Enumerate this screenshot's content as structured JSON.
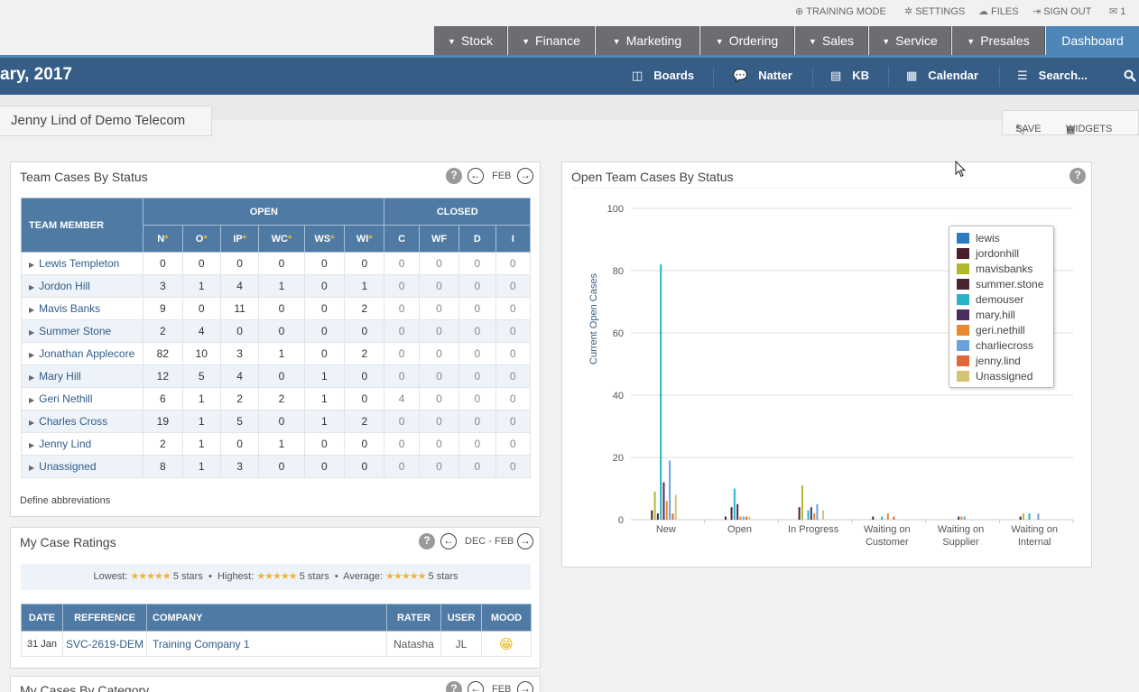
{
  "util": {
    "training": "TRAINING MODE",
    "settings": "SETTINGS",
    "files": "FILES",
    "signout": "SIGN OUT",
    "messages": "1"
  },
  "tabs": [
    "Stock",
    "Finance",
    "Marketing",
    "Ordering",
    "Sales",
    "Service",
    "Presales",
    "Dashboard"
  ],
  "nav": {
    "date_title": "ary, 2017",
    "boards": "Boards",
    "natter": "Natter",
    "kb": "KB",
    "calendar": "Calendar",
    "search": "Search..."
  },
  "context": {
    "user_tab": "Jenny Lind of Demo Telecom",
    "save": "SAVE",
    "widgets": "WIDGETS"
  },
  "team_cases": {
    "title": "Team Cases By Status",
    "period": "FEB",
    "header_member": "TEAM MEMBER",
    "header_open": "OPEN",
    "header_closed": "CLOSED",
    "open_cols": [
      "N",
      "O",
      "IP",
      "WC",
      "WS",
      "WI"
    ],
    "closed_cols": [
      "C",
      "WF",
      "D",
      "I"
    ],
    "rows": [
      {
        "name": "Lewis Templeton",
        "vals": [
          "0",
          "0",
          "0",
          "0",
          "0",
          "0",
          "0",
          "0",
          "0",
          "0"
        ]
      },
      {
        "name": "Jordon Hill",
        "vals": [
          "3",
          "1",
          "4",
          "1",
          "0",
          "1",
          "0",
          "0",
          "0",
          "0"
        ]
      },
      {
        "name": "Mavis Banks",
        "vals": [
          "9",
          "0",
          "11",
          "0",
          "0",
          "2",
          "0",
          "0",
          "0",
          "0"
        ]
      },
      {
        "name": "Summer Stone",
        "vals": [
          "2",
          "4",
          "0",
          "0",
          "0",
          "0",
          "0",
          "0",
          "0",
          "0"
        ]
      },
      {
        "name": "Jonathan Applecore",
        "vals": [
          "82",
          "10",
          "3",
          "1",
          "0",
          "2",
          "0",
          "0",
          "0",
          "0"
        ]
      },
      {
        "name": "Mary Hill",
        "vals": [
          "12",
          "5",
          "4",
          "0",
          "1",
          "0",
          "0",
          "0",
          "0",
          "0"
        ]
      },
      {
        "name": "Geri Nethill",
        "vals": [
          "6",
          "1",
          "2",
          "2",
          "1",
          "0",
          "4",
          "0",
          "0",
          "0"
        ]
      },
      {
        "name": "Charles Cross",
        "vals": [
          "19",
          "1",
          "5",
          "0",
          "1",
          "2",
          "0",
          "0",
          "0",
          "0"
        ]
      },
      {
        "name": "Jenny Lind",
        "vals": [
          "2",
          "1",
          "0",
          "1",
          "0",
          "0",
          "0",
          "0",
          "0",
          "0"
        ]
      },
      {
        "name": "Unassigned",
        "vals": [
          "8",
          "1",
          "3",
          "0",
          "0",
          "0",
          "0",
          "0",
          "0",
          "0"
        ]
      }
    ],
    "footer": "Define abbreviations"
  },
  "ratings": {
    "title": "My Case Ratings",
    "period": "DEC - FEB",
    "lowest_label": "Lowest:",
    "lowest_value": "5 stars",
    "highest_label": "Highest:",
    "highest_value": "5 stars",
    "average_label": "Average:",
    "average_value": "5 stars",
    "stars": "★★★★★",
    "dot": "•",
    "headers": [
      "DATE",
      "REFERENCE",
      "COMPANY",
      "RATER",
      "USER",
      "MOOD"
    ],
    "rows": [
      {
        "date": "31 Jan",
        "reference": "SVC-2619-DEM",
        "company": "Training Company 1",
        "rater": "Natasha",
        "user": "JL",
        "mood": "😁"
      }
    ]
  },
  "category": {
    "title": "My Cases By Category",
    "period": "FEB"
  },
  "open_chart_panel": {
    "title": "Open Team Cases By Status"
  },
  "chart_data": {
    "type": "bar",
    "title": "",
    "xlabel": "",
    "ylabel": "Current Open Cases",
    "ylim": [
      0,
      100
    ],
    "yticks": [
      0,
      20,
      40,
      60,
      80,
      100
    ],
    "grid": true,
    "legend_position": "top-right",
    "categories": [
      "New",
      "Open",
      "In Progress",
      "Waiting on Customer",
      "Waiting on Supplier",
      "Waiting on Internal"
    ],
    "category_lines": [
      [
        "New"
      ],
      [
        "Open"
      ],
      [
        "In Progress"
      ],
      [
        "Waiting on",
        "Customer"
      ],
      [
        "Waiting on",
        "Supplier"
      ],
      [
        "Waiting on",
        "Internal"
      ]
    ],
    "series": [
      {
        "name": "lewis",
        "color": "#2b7bc0",
        "values": [
          0,
          0,
          0,
          0,
          0,
          0
        ]
      },
      {
        "name": "jordonhill",
        "color": "#4a1f2c",
        "values": [
          3,
          1,
          4,
          1,
          0,
          1
        ]
      },
      {
        "name": "mavisbanks",
        "color": "#b2b82e",
        "values": [
          9,
          0,
          11,
          0,
          0,
          2
        ]
      },
      {
        "name": "summer.stone",
        "color": "#4a2433",
        "values": [
          2,
          4,
          0,
          0,
          0,
          0
        ]
      },
      {
        "name": "demouser",
        "color": "#27b4c8",
        "values": [
          82,
          10,
          3,
          1,
          0,
          2
        ]
      },
      {
        "name": "mary.hill",
        "color": "#4b2e5e",
        "values": [
          12,
          5,
          4,
          0,
          1,
          0
        ]
      },
      {
        "name": "geri.nethill",
        "color": "#e8892d",
        "values": [
          6,
          1,
          2,
          2,
          1,
          0
        ]
      },
      {
        "name": "charliecross",
        "color": "#6aa3db",
        "values": [
          19,
          1,
          5,
          0,
          1,
          2
        ]
      },
      {
        "name": "jenny.lind",
        "color": "#e0673a",
        "values": [
          2,
          1,
          0,
          1,
          0,
          0
        ]
      },
      {
        "name": "Unassigned",
        "color": "#d4c375",
        "values": [
          8,
          1,
          3,
          0,
          0,
          0
        ]
      }
    ]
  },
  "colors": {
    "nav_bg": "#365d85",
    "accent": "#4e86b8",
    "tab_bg": "#6b6d70",
    "table_header": "#4e7aa3",
    "alt_row": "#eef3f9",
    "star": "#f0b33a"
  },
  "icons": {
    "training": "globe-icon",
    "settings": "gear-icon",
    "files": "cloud-icon",
    "signout": "signout-icon",
    "messages": "speech-icon",
    "boards": "columns-icon",
    "natter": "chat-bubble-icon",
    "kb": "document-icon",
    "calendar": "calendar-icon",
    "search": "bars-icon",
    "search_glass": "magnifier-icon",
    "save": "bookmark-icon",
    "widgets": "grid-icon"
  }
}
